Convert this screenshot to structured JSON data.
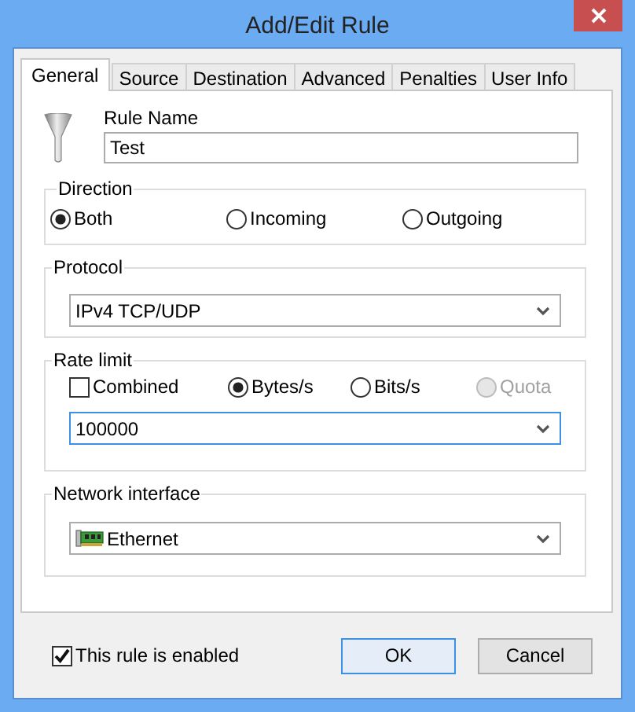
{
  "window": {
    "title": "Add/Edit Rule"
  },
  "tabs": [
    {
      "label": "General",
      "selected": true
    },
    {
      "label": "Source",
      "selected": false
    },
    {
      "label": "Destination",
      "selected": false
    },
    {
      "label": "Advanced",
      "selected": false
    },
    {
      "label": "Penalties",
      "selected": false
    },
    {
      "label": "User Info",
      "selected": false
    }
  ],
  "rule_name": {
    "label": "Rule Name",
    "value": "Test"
  },
  "direction": {
    "title": "Direction",
    "options": [
      {
        "label": "Both",
        "selected": true
      },
      {
        "label": "Incoming",
        "selected": false
      },
      {
        "label": "Outgoing",
        "selected": false
      }
    ]
  },
  "protocol": {
    "title": "Protocol",
    "value": "IPv4 TCP/UDP"
  },
  "rate_limit": {
    "title": "Rate limit",
    "focused": true,
    "value": "100000",
    "options": [
      {
        "kind": "checkbox",
        "label": "Combined",
        "checked": false,
        "disabled": false
      },
      {
        "kind": "radio",
        "label": "Bytes/s",
        "selected": true,
        "disabled": false
      },
      {
        "kind": "radio",
        "label": "Bits/s",
        "selected": false,
        "disabled": false
      },
      {
        "kind": "radio",
        "label": "Quota",
        "selected": false,
        "disabled": true
      }
    ]
  },
  "network_interface": {
    "title": "Network interface",
    "value": "Ethernet"
  },
  "enabled": {
    "label": "This rule is enabled",
    "checked": true
  },
  "buttons": [
    {
      "label": "OK",
      "default": true
    },
    {
      "label": "Cancel",
      "default": false
    }
  ]
}
